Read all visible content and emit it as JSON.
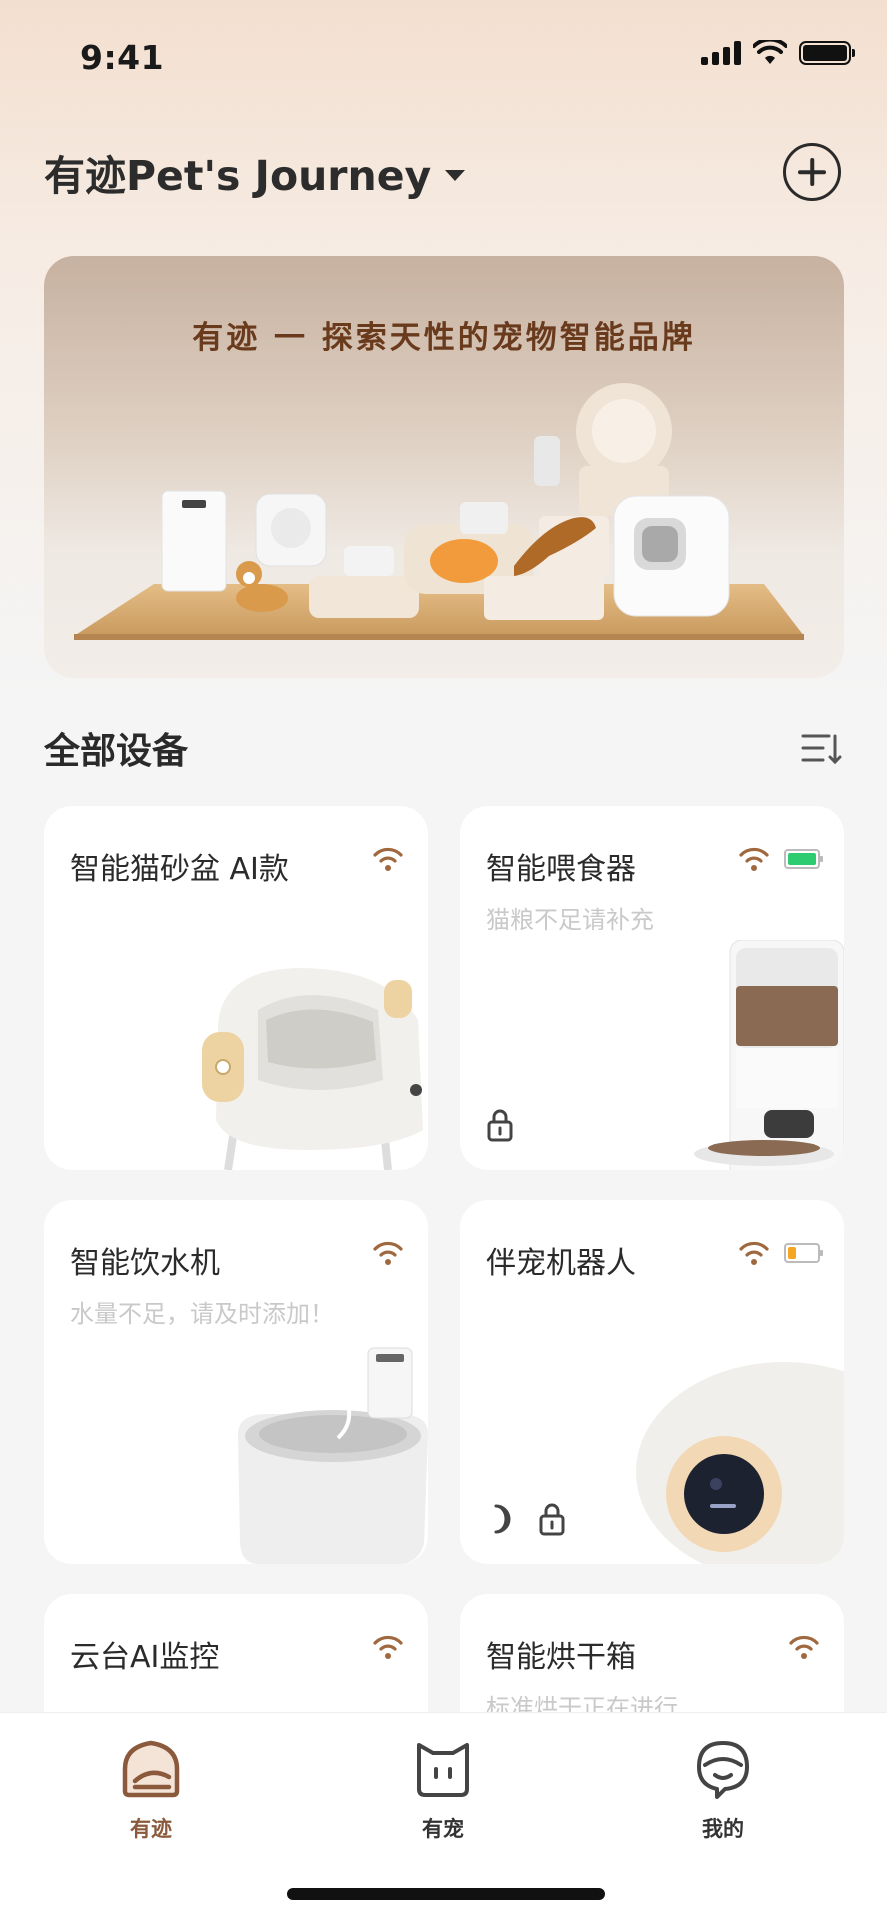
{
  "status_bar": {
    "time": "9:41"
  },
  "header": {
    "home_name": "有迹Pet's Journey"
  },
  "banner": {
    "title": "有迹 一 探索天性的宠物智能品牌"
  },
  "section": {
    "title": "全部设备"
  },
  "devices": [
    {
      "name": "智能猫砂盆 AI款",
      "status": "",
      "battery_level": null
    },
    {
      "name": "智能喂食器",
      "status": "猫粮不足请补充",
      "battery_level": 1.0,
      "battery_color": "#2ecc71"
    },
    {
      "name": "智能饮水机",
      "status": "水量不足，请及时添加！",
      "battery_level": null
    },
    {
      "name": "伴宠机器人",
      "status": "",
      "battery_level": 0.3,
      "battery_color": "#f5a623"
    },
    {
      "name": "云台AI监控",
      "status": "",
      "battery_level": null
    },
    {
      "name": "智能烘干箱",
      "status": "标准烘干正在进行",
      "battery_level": null
    }
  ],
  "tab_bar": {
    "tabs": [
      {
        "label": "有迹",
        "icon": "home-icon",
        "active": true
      },
      {
        "label": "有宠",
        "icon": "cat-face-icon",
        "active": false
      },
      {
        "label": "我的",
        "icon": "profile-icon",
        "active": false
      }
    ]
  },
  "colors": {
    "accent": "#8b5a3c",
    "wifi": "#a0683f",
    "background": "#f5f5f5"
  }
}
